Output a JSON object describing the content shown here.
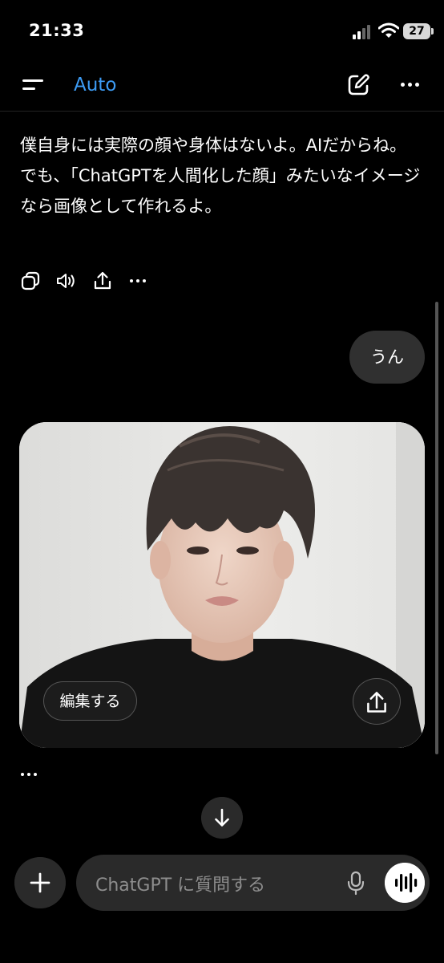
{
  "status_bar": {
    "time": "21:33",
    "battery": "27",
    "signal_icon": "cellular-signal-icon",
    "wifi_icon": "wifi-icon"
  },
  "header": {
    "menu_icon": "menu-icon",
    "model_label": "Auto",
    "model_label_color": "#3d9cf5",
    "new_chat_icon": "compose-icon",
    "more_icon": "more-horizontal-icon"
  },
  "assistant_message": {
    "lines": [
      "僕自身には実際の顔や身体はないよ。AIだからね。",
      "でも、「ChatGPTを人間化した顔」みたいなイメージなら画像として作れるよ。"
    ],
    "actions": [
      "copy-icon",
      "read-aloud-icon",
      "share-icon",
      "more-horizontal-icon"
    ]
  },
  "user_message": {
    "text": "うん"
  },
  "generated_image": {
    "subject": "portrait-image",
    "edit_label": "編集する",
    "share_icon": "share-icon"
  },
  "composer": {
    "add_icon": "plus-icon",
    "placeholder": "ChatGPT に質問する",
    "mic_icon": "microphone-icon",
    "voice_icon": "voice-mode-icon",
    "scroll_down_icon": "arrow-down-icon"
  },
  "colors": {
    "background": "#000000",
    "bubble": "#303030",
    "composer": "#2a2a2a",
    "accent": "#3d9cf5"
  }
}
